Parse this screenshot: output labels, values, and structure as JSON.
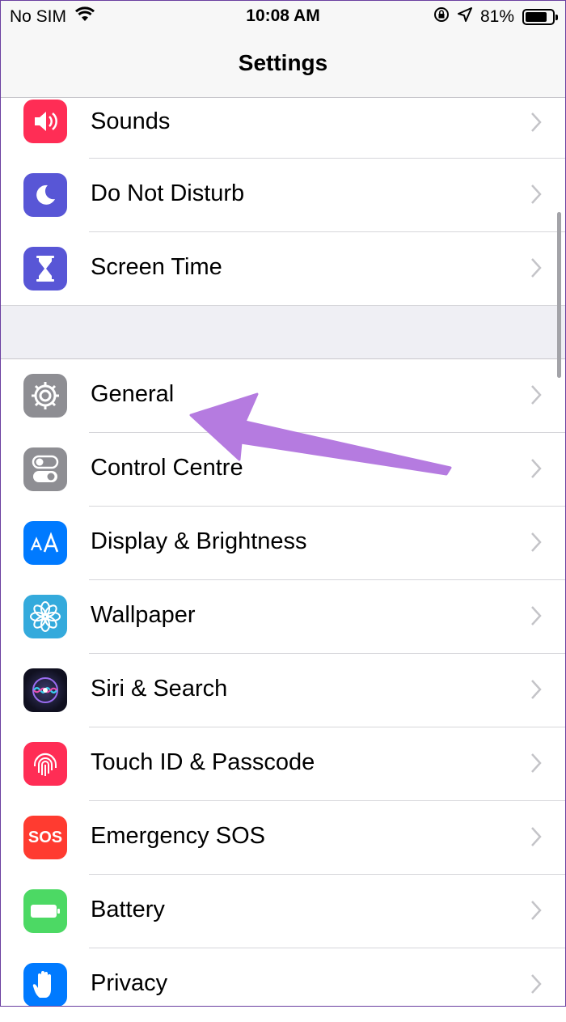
{
  "status_bar": {
    "carrier": "No SIM",
    "time": "10:08 AM",
    "battery_percent": "81%",
    "battery_level": 0.81
  },
  "nav": {
    "title": "Settings"
  },
  "rows": [
    {
      "label": "Sounds",
      "icon": "speaker-icon",
      "color": "#ff2d55"
    },
    {
      "label": "Do Not Disturb",
      "icon": "moon-icon",
      "color": "#5856d6"
    },
    {
      "label": "Screen Time",
      "icon": "hourglass-icon",
      "color": "#5856d6"
    },
    {
      "label": "General",
      "icon": "gear-icon",
      "color": "#8e8e93"
    },
    {
      "label": "Control Centre",
      "icon": "switches-icon",
      "color": "#8e8e93"
    },
    {
      "label": "Display & Brightness",
      "icon": "text-size-icon",
      "color": "#007aff"
    },
    {
      "label": "Wallpaper",
      "icon": "flower-icon",
      "color": "#34aadc"
    },
    {
      "label": "Siri & Search",
      "icon": "siri-icon",
      "color": "#1c1c3a"
    },
    {
      "label": "Touch ID & Passcode",
      "icon": "fingerprint-icon",
      "color": "#ff2d55"
    },
    {
      "label": "Emergency SOS",
      "icon": "sos-icon",
      "color": "#ff3b30",
      "icon_text": "SOS"
    },
    {
      "label": "Battery",
      "icon": "battery-icon",
      "color": "#4cd964"
    },
    {
      "label": "Privacy",
      "icon": "hand-icon",
      "color": "#007aff"
    }
  ],
  "annotation": {
    "icon": "arrow-icon",
    "color": "#b57be0"
  }
}
